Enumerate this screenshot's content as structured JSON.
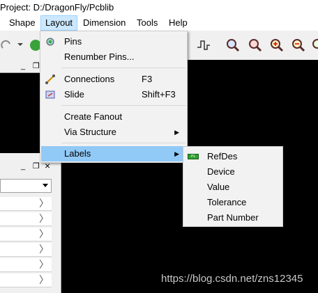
{
  "title": "Project: D:/DragonFly/Pcblib",
  "menubar": {
    "shape": "Shape",
    "layout": "Layout",
    "dimension": "Dimension",
    "tools": "Tools",
    "help": "Help"
  },
  "layout_menu": {
    "pins": "Pins",
    "renumber_pins": "Renumber Pins...",
    "connections": "Connections",
    "connections_shortcut": "F3",
    "slide": "Slide",
    "slide_shortcut": "Shift+F3",
    "create_fanout": "Create Fanout",
    "via_structure": "Via Structure",
    "labels": "Labels"
  },
  "labels_submenu": {
    "refdes": "RefDes",
    "device": "Device",
    "value": "Value",
    "tolerance": "Tolerance",
    "part_number": "Part Number",
    "refdes_icon_text": "P1"
  },
  "panels": {
    "minimize": "_",
    "restore": "❐",
    "close": "×"
  },
  "watermark": "https://blog.csdn.net/zns12345",
  "colors": {
    "menu_highlight": "#91c9f7",
    "menubar_open": "#cce8ff",
    "canvas": "#000000"
  }
}
